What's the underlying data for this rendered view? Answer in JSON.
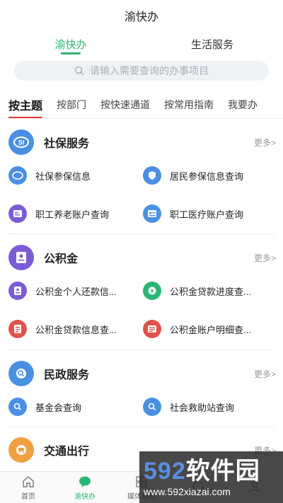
{
  "app": {
    "title": "渝快办"
  },
  "top_tabs": [
    {
      "label": "渝快办",
      "active": true
    },
    {
      "label": "生活服务",
      "active": false
    }
  ],
  "search": {
    "placeholder": "请输入需要查询的办事项目",
    "icon": "search-icon"
  },
  "category_tabs": [
    "按主题",
    "按部门",
    "按快速通道",
    "按常用指南",
    "我要办"
  ],
  "more_label": "更多>",
  "sections": [
    {
      "title": "社保服务",
      "icon": "social-security-icon",
      "color": "#4a90e2",
      "items": [
        {
          "label": "社保参保信息",
          "icon": "social-security-icon",
          "color": "#4a90e2"
        },
        {
          "label": "居民参保信息查询",
          "icon": "shield-icon",
          "color": "#4a90e2"
        },
        {
          "label": "职工养老账户查询",
          "icon": "account-card-icon",
          "color": "#7b5cd6"
        },
        {
          "label": "职工医疗账户查询",
          "icon": "id-card-icon",
          "color": "#4a90e2"
        }
      ]
    },
    {
      "title": "公积金",
      "icon": "fund-icon",
      "color": "#7b5cd6",
      "items": [
        {
          "label": "公积金个人还款信...",
          "icon": "person-card-icon",
          "color": "#7b5cd6"
        },
        {
          "label": "公积金贷款进度查...",
          "icon": "loan-progress-icon",
          "color": "#2bb673"
        },
        {
          "label": "公积金贷款信息查...",
          "icon": "loan-info-icon",
          "color": "#e0534a"
        },
        {
          "label": "公积金账户明细查...",
          "icon": "account-detail-icon",
          "color": "#e0534a"
        }
      ]
    },
    {
      "title": "民政服务",
      "icon": "civil-affairs-icon",
      "color": "#4a90e2",
      "items": [
        {
          "label": "基金会查询",
          "icon": "search-circle-icon",
          "color": "#4a90e2"
        },
        {
          "label": "社会救助站查询",
          "icon": "search-circle-icon",
          "color": "#4a90e2"
        }
      ]
    },
    {
      "title": "交通出行",
      "icon": "transport-icon",
      "color": "#f0a040",
      "items": []
    }
  ],
  "bottom_nav": [
    {
      "label": "首页",
      "icon": "home-icon",
      "active": false
    },
    {
      "label": "渝快办",
      "icon": "chat-bubble-icon",
      "active": true
    },
    {
      "label": "媒体矩阵",
      "icon": "grid-icon",
      "active": false
    },
    {
      "label": "",
      "icon": "service-icon",
      "active": false
    },
    {
      "label": "",
      "icon": "user-icon",
      "active": false
    }
  ],
  "watermark": {
    "brand_number": "592",
    "brand_text": "软件园",
    "url": "www.592xiazai.com"
  },
  "colors": {
    "accent": "#2bb673",
    "tab_underline": "#e53935"
  }
}
